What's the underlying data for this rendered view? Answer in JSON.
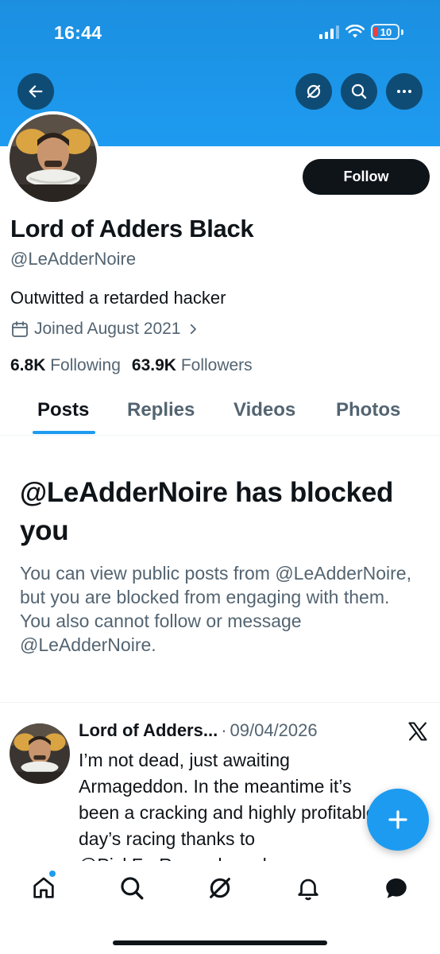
{
  "status_bar": {
    "time": "16:44",
    "battery": "10"
  },
  "profile": {
    "display_name": "Lord of Adders Black",
    "handle": "@LeAdderNoire",
    "bio": "Outwitted a retarded hacker",
    "joined": "Joined August 2021",
    "following_count": "6.8K",
    "following_label": "Following",
    "followers_count": "63.9K",
    "followers_label": "Followers",
    "follow_button": "Follow"
  },
  "tabs": [
    {
      "label": "Posts",
      "active": true
    },
    {
      "label": "Replies",
      "active": false
    },
    {
      "label": "Videos",
      "active": false
    },
    {
      "label": "Photos",
      "active": false
    }
  ],
  "blocked_notice": {
    "title": "@LeAdderNoire has blocked you",
    "body": "You can view public posts from @LeAdderNoire, but you are blocked from engaging with them. You also cannot follow or message @LeAdderNoire."
  },
  "post": {
    "author": "Lord of Adders...",
    "separator": "·",
    "date": "09/04/2026",
    "text": "I’m not dead, just awaiting Armageddon. In the meantime it’s been a cracking and highly profitable day’s racing thanks to @PickForRewards and"
  },
  "icons": {
    "back": "arrow-left-icon",
    "grok": "grok-icon",
    "search": "search-icon",
    "more": "more-icon",
    "calendar": "calendar-icon",
    "x_logo": "x-logo-icon",
    "compose": "plus-icon",
    "nav": [
      "home-icon",
      "search-icon",
      "grok-icon",
      "bell-icon",
      "messages-icon"
    ]
  },
  "colors": {
    "accent": "#1d9bf0",
    "banner": "#1d9bf0",
    "text": "#0f1419",
    "muted": "#536471"
  }
}
